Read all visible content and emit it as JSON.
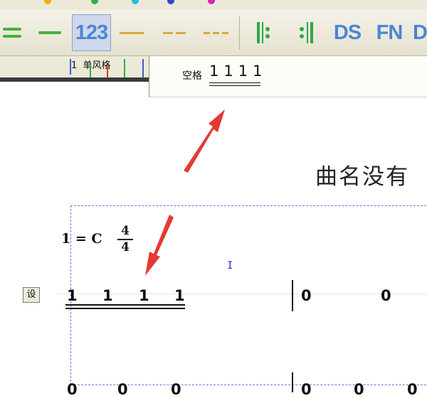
{
  "toolbar": {
    "number_button": "123",
    "ds_button": "DS",
    "fn_button": "FN",
    "d_button": "D"
  },
  "ruler": {
    "number": "1",
    "label": "单风格"
  },
  "preview": {
    "label": "空格",
    "notes": "1111"
  },
  "score": {
    "title": "曲名没有",
    "key_signature": "1 = C",
    "time_numerator": "4",
    "time_denominator": "4",
    "cursor": "I",
    "set_button": "设",
    "measure1_notes": [
      "1",
      "1",
      "1",
      "1"
    ],
    "measure2_notes": [
      "0",
      "0"
    ],
    "row2_notes": [
      "0",
      "0",
      "0",
      "0",
      "0",
      "0"
    ]
  },
  "colors": {
    "toolbar_bg": "#ece9d8",
    "accent_blue": "#4a86d8",
    "accent_green": "#46b23b",
    "accent_orange": "#d7a93e",
    "arrow_red": "#e53935",
    "frame_dash": "#7070e8"
  }
}
